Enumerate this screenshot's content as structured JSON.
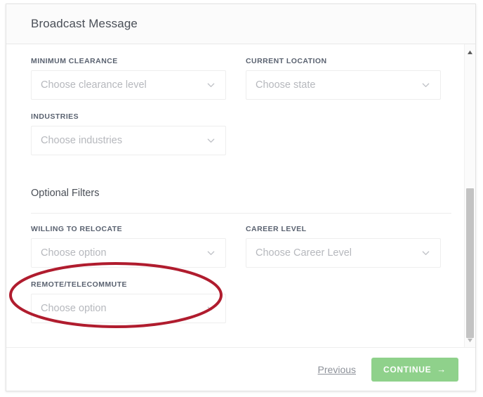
{
  "dialog": {
    "title": "Broadcast Message"
  },
  "form": {
    "required_fields": [
      {
        "label": "MINIMUM CLEARANCE",
        "placeholder": "Choose clearance level",
        "name": "minimum-clearance"
      },
      {
        "label": "CURRENT LOCATION",
        "placeholder": "Choose state",
        "name": "current-location"
      },
      {
        "label": "INDUSTRIES",
        "placeholder": "Choose industries",
        "name": "industries"
      }
    ],
    "section_heading": "Optional Filters",
    "optional_fields": [
      {
        "label": "WILLING TO RELOCATE",
        "placeholder": "Choose option",
        "name": "willing-to-relocate"
      },
      {
        "label": "CAREER LEVEL",
        "placeholder": "Choose Career Level",
        "name": "career-level"
      },
      {
        "label": "REMOTE/TELECOMMUTE",
        "placeholder": "Choose option",
        "name": "remote-telecommute"
      }
    ]
  },
  "footer": {
    "previous_label": "Previous",
    "continue_label": "CONTINUE",
    "continue_arrow": "→"
  },
  "annotation": {
    "shape": "ellipse",
    "target": "REMOTE/TELECOMMUTE",
    "color": "#b01c2e"
  },
  "colors": {
    "accent_green": "#8fd18b",
    "annotation_red": "#b01c2e",
    "label_gray": "#5a6270",
    "placeholder_gray": "#b6b8bd"
  },
  "icons": {
    "chevron_down": "chevron-down-icon",
    "scroll_up": "scroll-up-arrow-icon",
    "scroll_down": "scroll-down-arrow-icon"
  }
}
